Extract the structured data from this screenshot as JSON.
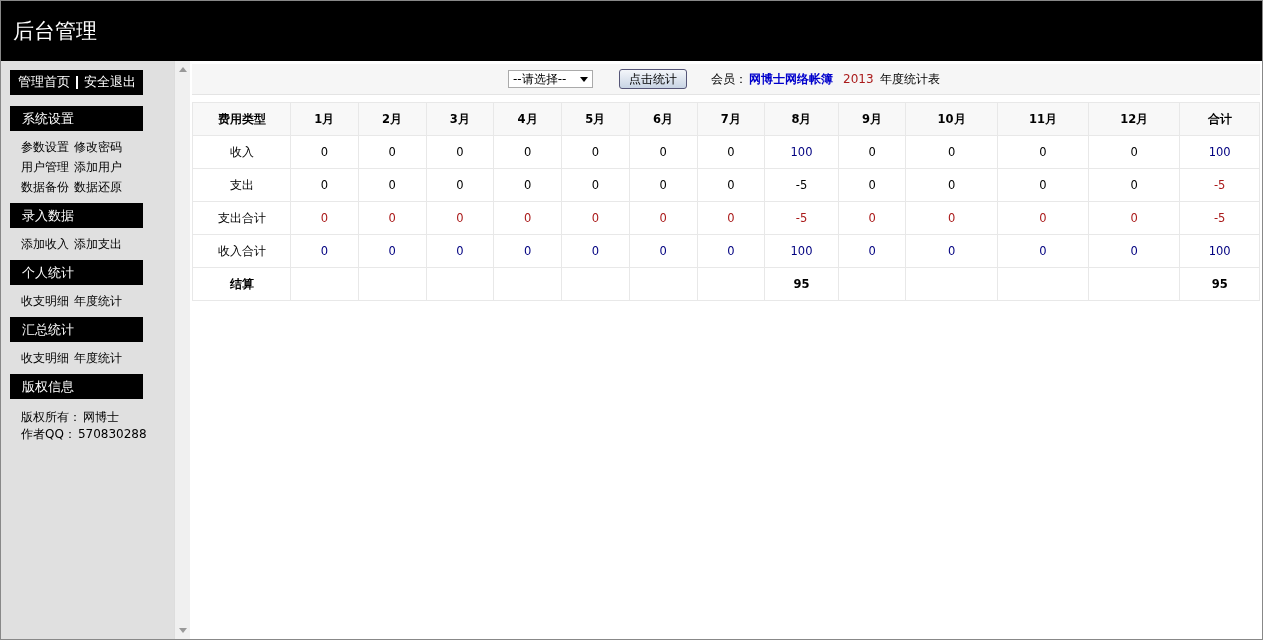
{
  "header": {
    "title": "后台管理"
  },
  "top_links": [
    "管理首页",
    "安全退出"
  ],
  "sidebar": [
    {
      "title": "系统设置",
      "lines": [
        [
          "参数设置",
          "修改密码"
        ],
        [
          "用户管理",
          "添加用户"
        ],
        [
          "数据备份",
          "数据还原"
        ]
      ]
    },
    {
      "title": "录入数据",
      "lines": [
        [
          "添加收入",
          "添加支出"
        ]
      ]
    },
    {
      "title": "个人统计",
      "lines": [
        [
          "收支明细",
          "年度统计"
        ]
      ]
    },
    {
      "title": "汇总统计",
      "lines": [
        [
          "收支明细",
          "年度统计"
        ]
      ]
    },
    {
      "title": "版权信息",
      "info": [
        {
          "label": "版权所有：",
          "value": "网博士"
        },
        {
          "label": "作者QQ：",
          "value": "570830288"
        }
      ]
    }
  ],
  "toolbar": {
    "select": "--请选择--",
    "button": "点击统计",
    "member_label": "会员：",
    "member": "网博士网络帐簿",
    "year": "2013",
    "suffix": "年度统计表"
  },
  "table": {
    "columns": [
      "费用类型",
      "1月",
      "2月",
      "3月",
      "4月",
      "5月",
      "6月",
      "7月",
      "8月",
      "9月",
      "10月",
      "11月",
      "12月",
      "合计"
    ],
    "rows": [
      {
        "bold": false,
        "cells": [
          {
            "value": "收入",
            "kind": "plain"
          },
          {
            "value": "0",
            "kind": "plain"
          },
          {
            "value": "0",
            "kind": "plain"
          },
          {
            "value": "0",
            "kind": "plain"
          },
          {
            "value": "0",
            "kind": "plain"
          },
          {
            "value": "0",
            "kind": "plain"
          },
          {
            "value": "0",
            "kind": "plain"
          },
          {
            "value": "0",
            "kind": "plain"
          },
          {
            "value": "100",
            "kind": "income"
          },
          {
            "value": "0",
            "kind": "plain"
          },
          {
            "value": "0",
            "kind": "plain"
          },
          {
            "value": "0",
            "kind": "plain"
          },
          {
            "value": "0",
            "kind": "plain"
          },
          {
            "value": "100",
            "kind": "income"
          }
        ]
      },
      {
        "bold": false,
        "cells": [
          {
            "value": "支出",
            "kind": "plain"
          },
          {
            "value": "0",
            "kind": "plain"
          },
          {
            "value": "0",
            "kind": "plain"
          },
          {
            "value": "0",
            "kind": "plain"
          },
          {
            "value": "0",
            "kind": "plain"
          },
          {
            "value": "0",
            "kind": "plain"
          },
          {
            "value": "0",
            "kind": "plain"
          },
          {
            "value": "0",
            "kind": "plain"
          },
          {
            "value": "-5",
            "kind": "plain"
          },
          {
            "value": "0",
            "kind": "plain"
          },
          {
            "value": "0",
            "kind": "plain"
          },
          {
            "value": "0",
            "kind": "plain"
          },
          {
            "value": "0",
            "kind": "plain"
          },
          {
            "value": "-5",
            "kind": "expense"
          }
        ]
      },
      {
        "bold": false,
        "cells": [
          {
            "value": "支出合计",
            "kind": "plain"
          },
          {
            "value": "0",
            "kind": "expense"
          },
          {
            "value": "0",
            "kind": "expense"
          },
          {
            "value": "0",
            "kind": "expense"
          },
          {
            "value": "0",
            "kind": "expense"
          },
          {
            "value": "0",
            "kind": "expense"
          },
          {
            "value": "0",
            "kind": "expense"
          },
          {
            "value": "0",
            "kind": "expense"
          },
          {
            "value": "-5",
            "kind": "expense"
          },
          {
            "value": "0",
            "kind": "expense"
          },
          {
            "value": "0",
            "kind": "expense"
          },
          {
            "value": "0",
            "kind": "expense"
          },
          {
            "value": "0",
            "kind": "expense"
          },
          {
            "value": "-5",
            "kind": "expense"
          }
        ]
      },
      {
        "bold": false,
        "cells": [
          {
            "value": "收入合计",
            "kind": "plain"
          },
          {
            "value": "0",
            "kind": "income"
          },
          {
            "value": "0",
            "kind": "income"
          },
          {
            "value": "0",
            "kind": "income"
          },
          {
            "value": "0",
            "kind": "income"
          },
          {
            "value": "0",
            "kind": "income"
          },
          {
            "value": "0",
            "kind": "income"
          },
          {
            "value": "0",
            "kind": "income"
          },
          {
            "value": "100",
            "kind": "income"
          },
          {
            "value": "0",
            "kind": "income"
          },
          {
            "value": "0",
            "kind": "income"
          },
          {
            "value": "0",
            "kind": "income"
          },
          {
            "value": "0",
            "kind": "income"
          },
          {
            "value": "100",
            "kind": "income"
          }
        ]
      },
      {
        "bold": true,
        "cells": [
          {
            "value": "结算",
            "kind": "plain"
          },
          null,
          null,
          null,
          null,
          null,
          null,
          null,
          {
            "value": "95",
            "kind": "plain"
          },
          null,
          null,
          null,
          null,
          {
            "value": "95",
            "kind": "plain"
          }
        ]
      }
    ]
  }
}
